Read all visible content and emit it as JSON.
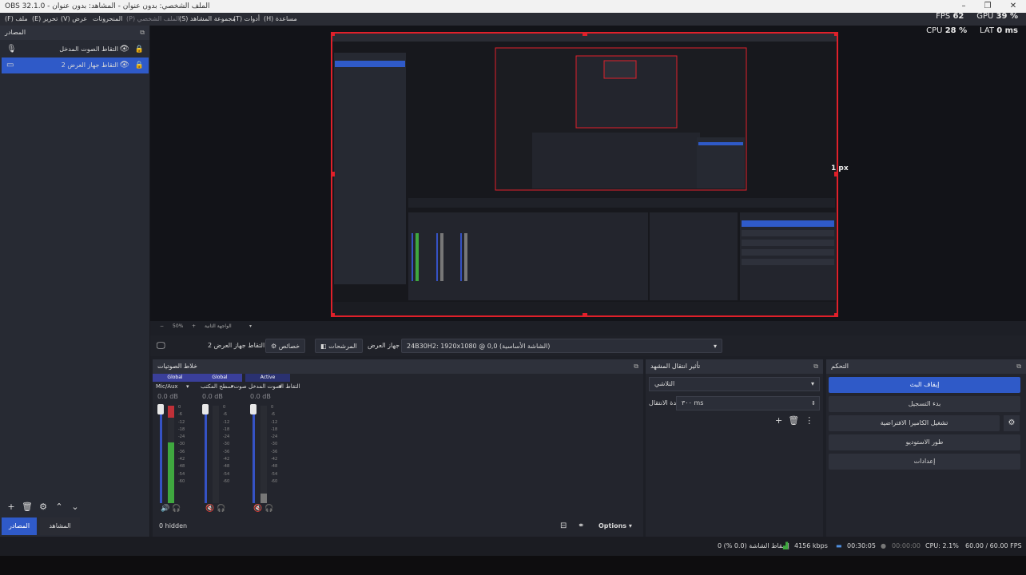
{
  "window": {
    "title": "OBS 32.1.0 - الملف الشخصي: بدون عنوان - المشاهد: بدون عنوان",
    "minimize": "–",
    "restore": "❐",
    "close": "✕"
  },
  "menu": {
    "file": "(F) ملف",
    "edit": "(E) تحرير",
    "view": "(V) عرض",
    "docks": "المنحرونات",
    "profile": "(P) الملف الشخصي",
    "scene_collection": "(S) مجموعة المشاهد",
    "tools": "(T) أدوات",
    "help": "(H) مساعدة"
  },
  "stats": {
    "fps_label": "FPS",
    "fps_value": "62",
    "gpu_label": "GPU",
    "gpu_value": "39 %",
    "cpu_label": "CPU",
    "cpu_value": "28 %",
    "lat_label": "LAT",
    "lat_value": "0 ms"
  },
  "sources_dock": {
    "title": "المصادر",
    "undock_icon": "undock-icon",
    "items": [
      {
        "label": "التقاط الصوت المدخل",
        "icon": "microphone-icon",
        "selected": false
      },
      {
        "label": "التقاط جهاز العرض 2",
        "icon": "monitor-icon",
        "selected": true
      }
    ]
  },
  "bottom_tabs": {
    "sources": "المصادر",
    "scenes": "المشاهد"
  },
  "preview": {
    "px_label": "1 px",
    "zoom_text": "50%",
    "nested_label": "الواجهة الثانية"
  },
  "context_bar": {
    "source_name": "التقاط جهاز العرض 2",
    "properties": "خصائص",
    "filters": "المرشحات",
    "display_label": "جهاز العرض",
    "display_value": "24B30H2: 1920x1080 @ 0,0 (الشاشة الأساسية)"
  },
  "mixer": {
    "title": "خلاط الصوتيات",
    "channels": [
      {
        "head": "Global",
        "name": "Mic/Aux",
        "db": "0.0 dB",
        "level": 0.62,
        "muted": false
      },
      {
        "head": "Global",
        "name": "صوت سطح المكتب",
        "db": "0.0 dB",
        "level": 0.0,
        "muted": true
      },
      {
        "head": "Active",
        "name": "التقاط الصوت المدخل",
        "db": "0.0 dB",
        "level": 0.1,
        "muted": true
      }
    ],
    "ticks": [
      "0",
      "-6",
      "-12",
      "-18",
      "-24",
      "-30",
      "-36",
      "-42",
      "-48",
      "-54",
      "-60"
    ],
    "hidden_label": "0 hidden",
    "options": "Options"
  },
  "transitions": {
    "title": "تأثير انتقال المشهد",
    "type": "التلاشي",
    "duration_label": "مدة الانتقال",
    "duration_value": "٣٠٠ ms"
  },
  "controls": {
    "title": "التحكم",
    "stop_stream": "إيقاف البث",
    "start_recording": "بدء التسجيل",
    "virtual_camera": "تشغيل الكاميرا الافتراضية",
    "studio_mode": "طور الاستوديو",
    "settings": "إعدادات"
  },
  "status": {
    "dropped": "إسقاط الشاشة (0.0 %) 0",
    "bitrate": "4156 kbps",
    "stream_time": "00:30:05",
    "rec_time": "00:00:00",
    "cpu": "CPU: 2.1%",
    "fps": "60.00 / 60.00 FPS"
  },
  "colors": {
    "accent": "#2f5ac8",
    "selection_border": "#e0202a",
    "meter_green": "#3fa83f",
    "meter_red": "#c03038"
  }
}
